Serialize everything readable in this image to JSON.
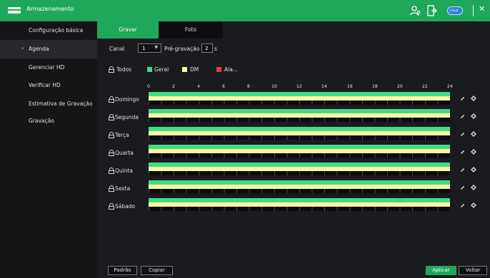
{
  "window": {
    "title": "Armazenamento",
    "pill_label": "Cloud",
    "icons": [
      "storage-icon",
      "user-icon",
      "exit-icon",
      "cloud-pill-icon",
      "close-icon"
    ]
  },
  "sidebar": {
    "items": [
      {
        "label": "Configuração básica",
        "active": false
      },
      {
        "label": "Agenda",
        "active": true
      },
      {
        "label": "Gerenciar HD",
        "active": false
      },
      {
        "label": "Verificar HD",
        "active": false
      },
      {
        "label": "Estimativa de Gravação",
        "active": false
      },
      {
        "label": "Gravação",
        "active": false
      }
    ]
  },
  "tabs": [
    {
      "label": "Gravar",
      "active": true
    },
    {
      "label": "Foto",
      "active": false
    }
  ],
  "controls": {
    "canal_label": "Canal",
    "canal_value": "1",
    "pregravacao_label": "Pré-gravação",
    "pregravacao_value": "2",
    "pregravacao_unit": "s"
  },
  "legend": {
    "todos": "Todos",
    "items": [
      {
        "label": "Geral",
        "color": "#3fdd86"
      },
      {
        "label": "DM",
        "color": "#fff4a3"
      },
      {
        "label": "Ala...",
        "color": "#e23b3b"
      }
    ]
  },
  "hours": [
    "0",
    "2",
    "4",
    "6",
    "8",
    "10",
    "12",
    "14",
    "16",
    "18",
    "20",
    "22",
    "24"
  ],
  "days": [
    {
      "label": "Domingo",
      "geral": [
        0,
        24
      ],
      "dm": [
        0,
        24
      ]
    },
    {
      "label": "Segunda",
      "geral": [
        0,
        24
      ],
      "dm": [
        0,
        24
      ]
    },
    {
      "label": "Terça",
      "geral": [
        0,
        24
      ],
      "dm": [
        0,
        24
      ]
    },
    {
      "label": "Quarta",
      "geral": [
        0,
        24
      ],
      "dm": [
        0,
        24
      ]
    },
    {
      "label": "Quinta",
      "geral": [
        0,
        24
      ],
      "dm": [
        0,
        24
      ]
    },
    {
      "label": "Sexta",
      "geral": [
        0,
        24
      ],
      "dm": [
        0,
        24
      ]
    },
    {
      "label": "Sábado",
      "geral": [
        0,
        24
      ],
      "dm": [
        0,
        24
      ]
    }
  ],
  "buttons": {
    "padrao": "Padrão",
    "copiar": "Copiar",
    "aplicar": "Aplicar",
    "voltar": "Voltar"
  },
  "colors": {
    "accent": "#1fa85a",
    "geral": "#3fdd86",
    "dm": "#fff4a3",
    "alarme": "#e23b3b"
  }
}
